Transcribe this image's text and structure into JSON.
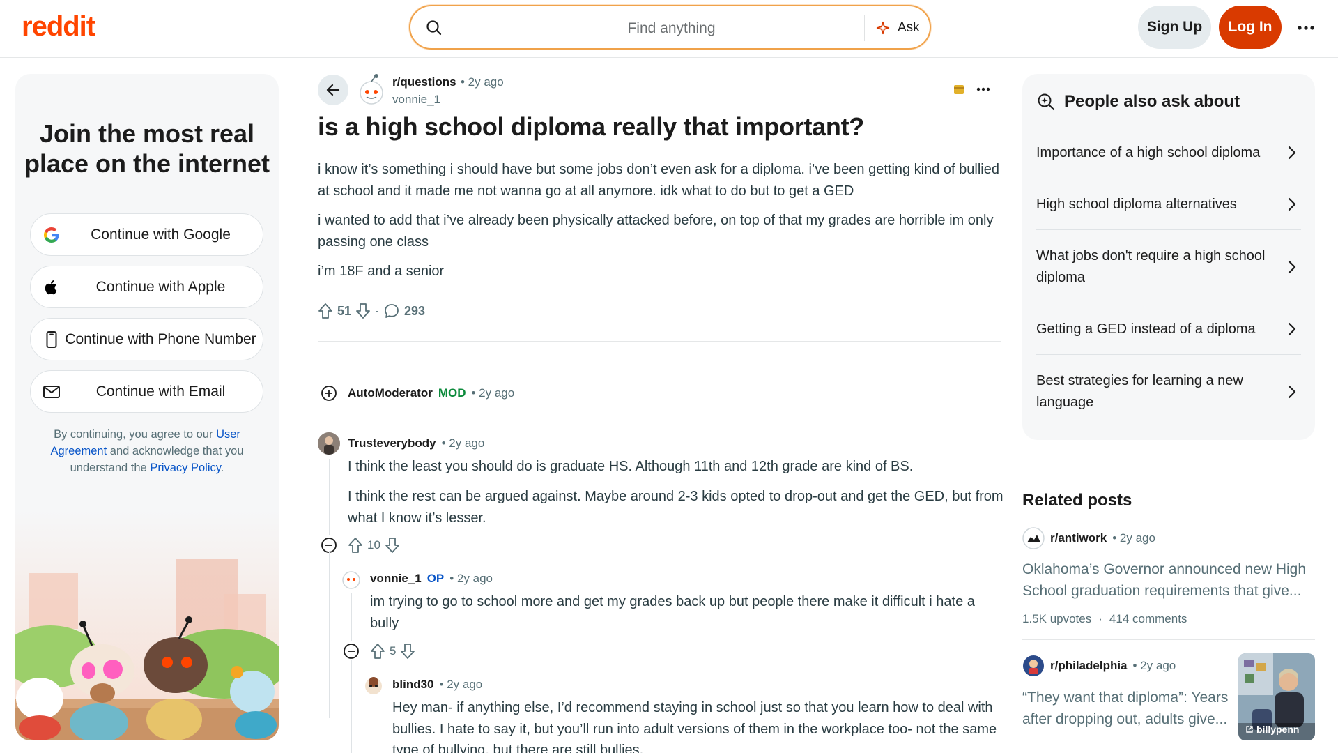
{
  "header": {
    "logo": "reddit",
    "search_placeholder": "Find anything",
    "ask_label": "Ask",
    "signup_label": "Sign Up",
    "login_label": "Log In"
  },
  "left_panel": {
    "title": "Join the most real place on the internet",
    "auth_buttons": [
      {
        "label": "Continue with Google",
        "icon": "google-icon"
      },
      {
        "label": "Continue with Apple",
        "icon": "apple-icon"
      },
      {
        "label": "Continue with Phone Number",
        "icon": "phone-icon"
      },
      {
        "label": "Continue with Email",
        "icon": "mail-icon"
      }
    ],
    "terms": {
      "prefix": "By continuing, you agree to our",
      "user_agreement": "User Agreement",
      "middle": "and acknowledge that you understand the",
      "privacy_policy": "Privacy Policy",
      "suffix": "."
    }
  },
  "post": {
    "subreddit": "r/questions",
    "time": "• 2y ago",
    "author": "vonnie_1",
    "title": "is a high school diploma really that important?",
    "paragraphs": [
      "i know it’s something i should have but some jobs don’t even ask for a diploma. i’ve been getting kind of bullied at school and it made me not wanna go at all anymore. idk what to do but to get a GED",
      "i wanted to add that i’ve already been physically attacked before, on top of that my grades are horrible im only passing one class",
      "i’m 18F and a senior"
    ],
    "upvotes": "51",
    "separator": "·",
    "comments": "293"
  },
  "comments": [
    {
      "user": "AutoModerator",
      "badge": "MOD",
      "time": "• 2y ago"
    },
    {
      "user": "Trusteverybody",
      "time": "• 2y ago",
      "paragraphs": [
        "I think the least you should do is graduate HS. Although 11th and 12th grade are kind of BS.",
        "I think the rest can be argued against. Maybe around 2-3 kids opted to drop-out and get the GED, but from what I know it’s lesser."
      ],
      "votes": "10"
    },
    {
      "user": "vonnie_1",
      "badge": "OP",
      "time": "• 2y ago",
      "paragraphs": [
        "im trying to go to school more and get my grades back up but people there make it difficult i hate a bully"
      ],
      "votes": "5"
    },
    {
      "user": "blind30",
      "time": "• 2y ago",
      "paragraphs": [
        "Hey man- if anything else, I’d recommend staying in school just so that you learn how to deal with bullies. I hate to say it, but you’ll run into adult versions of them in the workplace too- not the same type of bullying, but there are still bullies."
      ]
    }
  ],
  "people_also_ask": {
    "title": "People also ask about",
    "items": [
      "Importance of a high school diploma",
      "High school diploma alternatives",
      "What jobs don't require a high school diploma",
      "Getting a GED instead of a diploma",
      "Best strategies for learning a new language"
    ]
  },
  "related": {
    "title": "Related posts",
    "posts": [
      {
        "subreddit": "r/antiwork",
        "time": "• 2y ago",
        "headline": "Oklahoma’s Governor announced new High School graduation requirements that give...",
        "upvotes": "1.5K upvotes",
        "dot": "·",
        "comments": "414 comments"
      },
      {
        "subreddit": "r/philadelphia",
        "time": "• 2y ago",
        "headline": "“They want that diploma”: Years after dropping out, adults give...",
        "thumb_label": "billypenn"
      }
    ]
  },
  "colors": {
    "brand": "#ff4500",
    "login": "#d93a00",
    "mod": "#0b8a3b",
    "op": "#0a56c8",
    "link": "#0a56c8"
  }
}
